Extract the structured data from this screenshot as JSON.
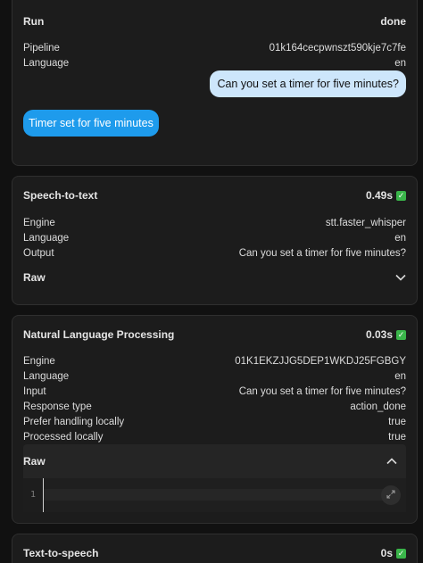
{
  "run": {
    "title": "Run",
    "status": "done",
    "rows": [
      {
        "label": "Pipeline",
        "value": "01k164cecpwnszt590kje7c7fe"
      },
      {
        "label": "Language",
        "value": "en"
      }
    ],
    "user_message": "Can you set a timer for five minutes?",
    "assistant_message": "Timer set for five minutes"
  },
  "stt": {
    "title": "Speech-to-text",
    "duration": "0.49s",
    "rows": [
      {
        "label": "Engine",
        "value": "stt.faster_whisper"
      },
      {
        "label": "Language",
        "value": "en"
      },
      {
        "label": "Output",
        "value": "Can you set a timer for five minutes?"
      }
    ],
    "raw_label": "Raw"
  },
  "nlp": {
    "title": "Natural Language Processing",
    "duration": "0.03s",
    "rows": [
      {
        "label": "Engine",
        "value": "01K1EKZJJG5DEP1WKDJ25FGBGY"
      },
      {
        "label": "Language",
        "value": "en"
      },
      {
        "label": "Input",
        "value": "Can you set a timer for five minutes?"
      },
      {
        "label": "Response type",
        "value": "action_done"
      },
      {
        "label": "Prefer handling locally",
        "value": "true"
      },
      {
        "label": "Processed locally",
        "value": "true"
      }
    ],
    "raw_label": "Raw",
    "line_number": "1"
  },
  "tts": {
    "title": "Text-to-speech",
    "duration": "0s"
  },
  "icons": {
    "check": "check-icon",
    "chevron_down": "chevron-down-icon",
    "chevron_up": "chevron-up-icon",
    "expand": "expand-icon"
  },
  "colors": {
    "background": "#111111",
    "card": "#1c1c1c",
    "user_bubble": "#cde6fb",
    "assistant_bubble": "#1e9bec",
    "success": "#3ab54a"
  }
}
